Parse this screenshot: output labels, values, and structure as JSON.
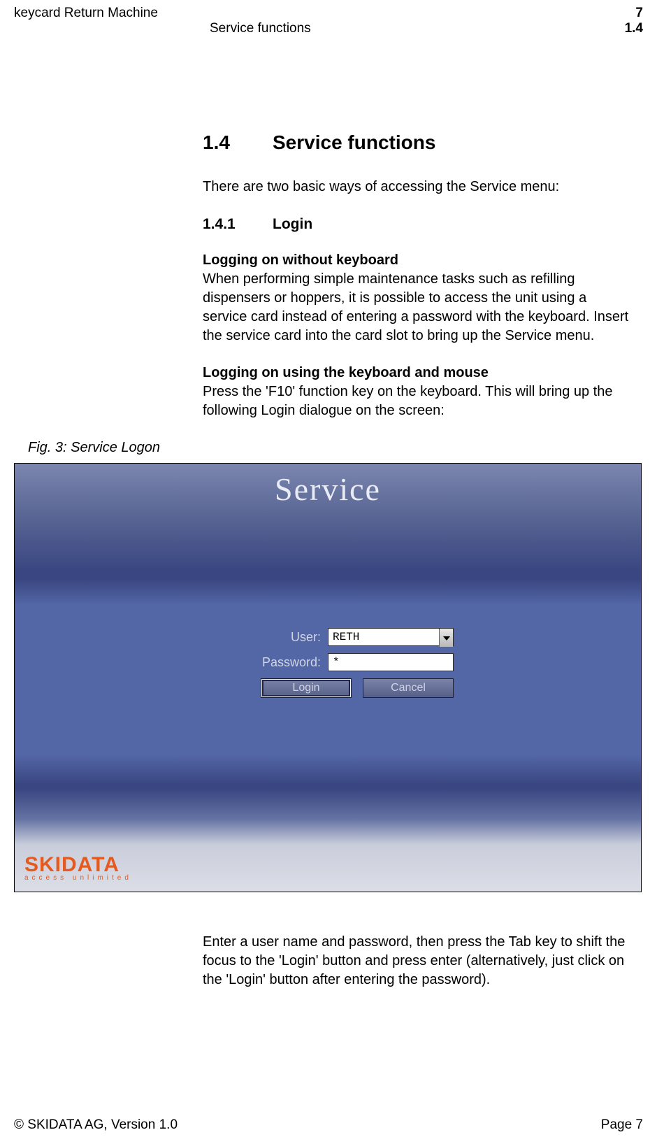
{
  "header": {
    "doc_title": "keycard Return Machine",
    "chapter_number": "7",
    "subtitle": "Service functions",
    "section_number": "1.4"
  },
  "section": {
    "heading_num": "1.4",
    "heading_text": "Service functions",
    "intro": "There are two basic ways of accessing the Service menu:",
    "sub_num": "1.4.1",
    "sub_text": "Login",
    "para1_bold": "Logging on without keyboard",
    "para1_body": "When performing simple maintenance tasks such as refilling dispensers or hoppers, it is possible to access the unit using a service card instead of entering a password with the keyboard. Insert the service card into the card slot to bring up the Service menu.",
    "para2_bold": "Logging on using the keyboard and mouse",
    "para2_body": "Press the 'F10' function key on the keyboard. This will bring up the following Login dialogue on the screen:"
  },
  "figure": {
    "caption": "Fig. 3: Service Logon",
    "window_title": "Service",
    "user_label": "User:",
    "user_value": "RETH",
    "password_label": "Password:",
    "password_value": "*",
    "login_btn": "Login",
    "cancel_btn": "Cancel",
    "brand_main": "SKIDATA",
    "brand_sub": "access unlimited"
  },
  "after_figure": "Enter a user name and password, then press the Tab key to shift the focus to the 'Login' button and press enter (alternatively, just click on the 'Login' button after entering the password).",
  "footer": {
    "left": "© SKIDATA AG, Version 1.0",
    "right": "Page 7"
  }
}
